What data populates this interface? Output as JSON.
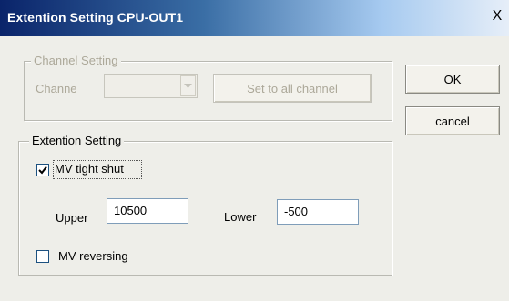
{
  "window": {
    "title": "Extention Setting CPU-OUT1",
    "close_glyph": "X"
  },
  "channel_setting": {
    "legend": "Channel Setting",
    "channel_label": "Channe",
    "channel_value": "",
    "set_all_button": "Set to all channel"
  },
  "buttons": {
    "ok": "OK",
    "cancel": "cancel"
  },
  "extention_setting": {
    "legend": "Extention Setting",
    "mv_tight_shut": {
      "label": "MV tight shut",
      "checked": true
    },
    "upper_label": "Upper",
    "upper_value": "10500",
    "lower_label": "Lower",
    "lower_value": "-500",
    "mv_reversing": {
      "label": "MV reversing",
      "checked": false
    }
  },
  "colors": {
    "title_start": "#0a246a",
    "title_end": "#e6eef8",
    "dialog_bg": "#eeeee9",
    "disabled_text": "#aca899"
  }
}
